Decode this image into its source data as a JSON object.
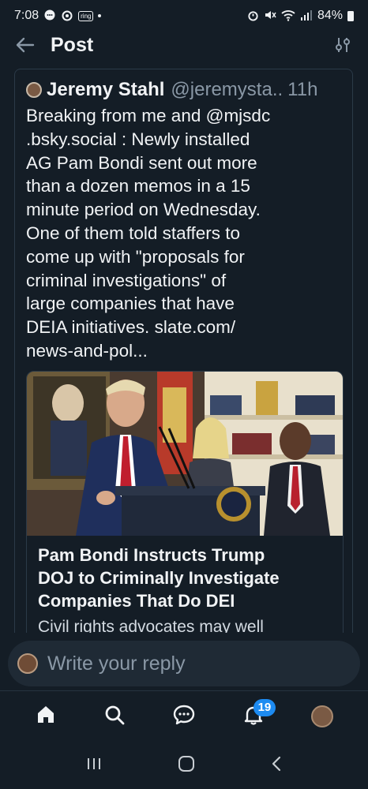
{
  "status": {
    "time": "7:08",
    "ring_label": "ring",
    "battery": "84%"
  },
  "header": {
    "title": "Post"
  },
  "post": {
    "author_name": "Jeremy Stahl",
    "author_handle": "@jeremysta..",
    "time": "11h",
    "text": "Breaking from me and @mjsdc .bsky.social : Newly installed AG Pam Bondi sent out more than a dozen memos in a 15 minute period on Wednesday. One of them told staffers to come up with \"proposals for criminal investigations\" of large companies that have DEIA initiatives. slate.com/ news-and-pol...",
    "text_lines": [
      "Breaking from me and @mjsdc",
      ".bsky.social : Newly installed",
      "AG Pam Bondi sent out more",
      "than a dozen memos in a 15",
      "minute period on Wednesday.",
      "One of them told staffers to",
      "come up with \"proposals for",
      "criminal investigations\" of",
      "large companies that have",
      "DEIA initiatives. slate.com/",
      "news-and-pol..."
    ]
  },
  "link_card": {
    "title_lines": [
      "Pam Bondi Instructs Trump",
      "DOJ to Criminally Investigate",
      "Companies That Do DEI"
    ],
    "description": "Civil rights advocates may well"
  },
  "reply": {
    "placeholder": "Write your reply"
  },
  "nav": {
    "notifications_badge": "19"
  },
  "colors": {
    "background": "#141d26",
    "accent": "#1d8bf1",
    "muted_text": "#8a98a6"
  }
}
